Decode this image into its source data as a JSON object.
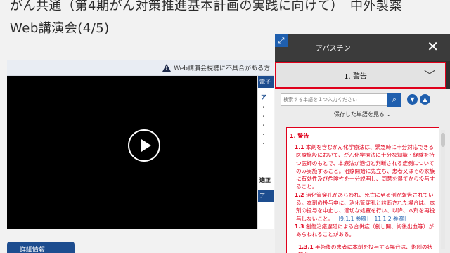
{
  "header": {
    "title_line1": "がん共通（第4期がん対策推進基本計画の実践に向けて）　中外製薬",
    "title_line2": "Web講演会(4/5)"
  },
  "notice": {
    "text": "Web講演会視聴に不具合がある方"
  },
  "info_panel": {
    "header": "電子",
    "sub": "ア",
    "dots": [
      "・",
      "・",
      "・",
      "・",
      "・"
    ],
    "header2": "適正",
    "header3": "ア"
  },
  "bottom_button": {
    "label": "詳細情報"
  },
  "drawer": {
    "title": "アバスチン",
    "section_label": "1. 警告",
    "search_placeholder": "検索する単語を１つ入力ください",
    "saved_terms_label": "保存した単語を見る",
    "doc": {
      "heading": "1. 警告",
      "p1_num": "1.1",
      "p1": "本剤を含むがん化学療法は、緊急時に十分対応できる医療施設において、がん化学療法に十分な知識・経験を持つ医師のもとで、本療法が適切と判断される症例についてのみ実施すること。治療開始に先立ち、患者又はその家族に有効性及び危険性を十分説明し、同意を得てから投与すること。",
      "p2_num": "1.2",
      "p2": "消化管穿孔があらわれ、死亡に至る例が報告されている。本剤の投与中に、消化管穿孔と診断された場合は、本剤の投与を中止し、適切な処置を行い、以降、本剤を再投与しないこと。",
      "p2_ref": "［9.1.1 参照］［11.1.2 参照］",
      "p3_num": "1.3",
      "p3": "創傷治癒遅延による合併症（創し開、術後出血等）があらわれることがある。",
      "p4_num": "1.3.1",
      "p4": "手術後の患者に本剤を投与する場合は、術創の状態を"
    }
  },
  "colors": {
    "accent": "#1f5fae",
    "warning_red": "#e0001b",
    "dark": "#3b3b3b"
  }
}
